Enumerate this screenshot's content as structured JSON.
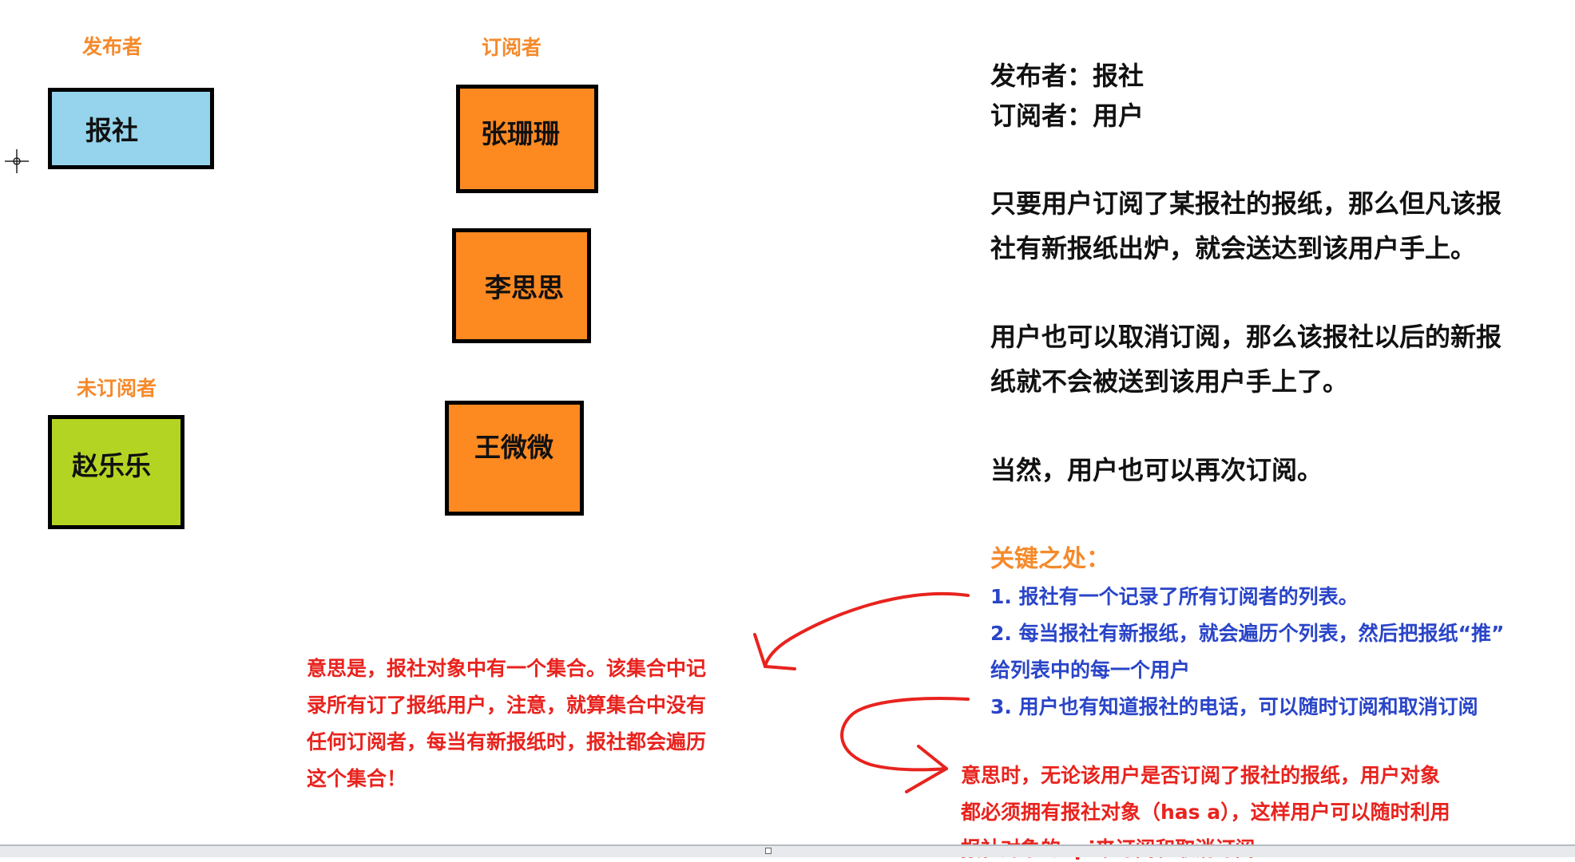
{
  "diagram": {
    "labels": {
      "publisher_header": "发布者",
      "subscriber_header": "订阅者",
      "non_subscriber_header": "未订阅者"
    },
    "boxes": {
      "newspaper": "报社",
      "zhang": "张珊珊",
      "li": "李思思",
      "wang": "王微微",
      "zhao": "赵乐乐"
    }
  },
  "explanation": {
    "line1": "发布者：报社",
    "line2": "订阅者：用户",
    "para1_line1": "只要用户订阅了某报社的报纸，那么但凡该报",
    "para1_line2": "社有新报纸出炉，就会送达到该用户手上。",
    "para2_line1": "用户也可以取消订阅，那么该报社以后的新报",
    "para2_line2": "纸就不会被送到该用户手上了。",
    "para3": "当然，用户也可以再次订阅。"
  },
  "key_points": {
    "title": "关键之处：",
    "point1": "1. 报社有一个记录了所有订阅者的列表。",
    "point2_line1": "2. 每当报社有新报纸，就会遍历个列表，然后把报纸“推”",
    "point2_line2": "给列表中的每一个用户",
    "point3": "3. 用户也有知道报社的电话，可以随时订阅和取消订阅"
  },
  "note_left": {
    "line1": "意思是，报社对象中有一个集合。该集合中记",
    "line2": "录所有订了报纸用户，注意，就算集合中没有",
    "line3": "任何订阅者，每当有新报纸时，报社都会遍历",
    "line4": "这个集合！"
  },
  "note_right": {
    "line1": "意思时，无论该用户是否订阅了报社的报纸，用户对象",
    "line2": "都必须拥有报社对象（has a），这样用户可以随时利用",
    "line3": "报社对象的api来订阅和取消订阅"
  },
  "colors": {
    "orange_box": "#fd8921",
    "blue_box": "#95d4ec",
    "green_box": "#b4d423",
    "header_orange": "#f58a2b",
    "blue_text": "#2a45c8",
    "red_text": "#e8231e"
  }
}
